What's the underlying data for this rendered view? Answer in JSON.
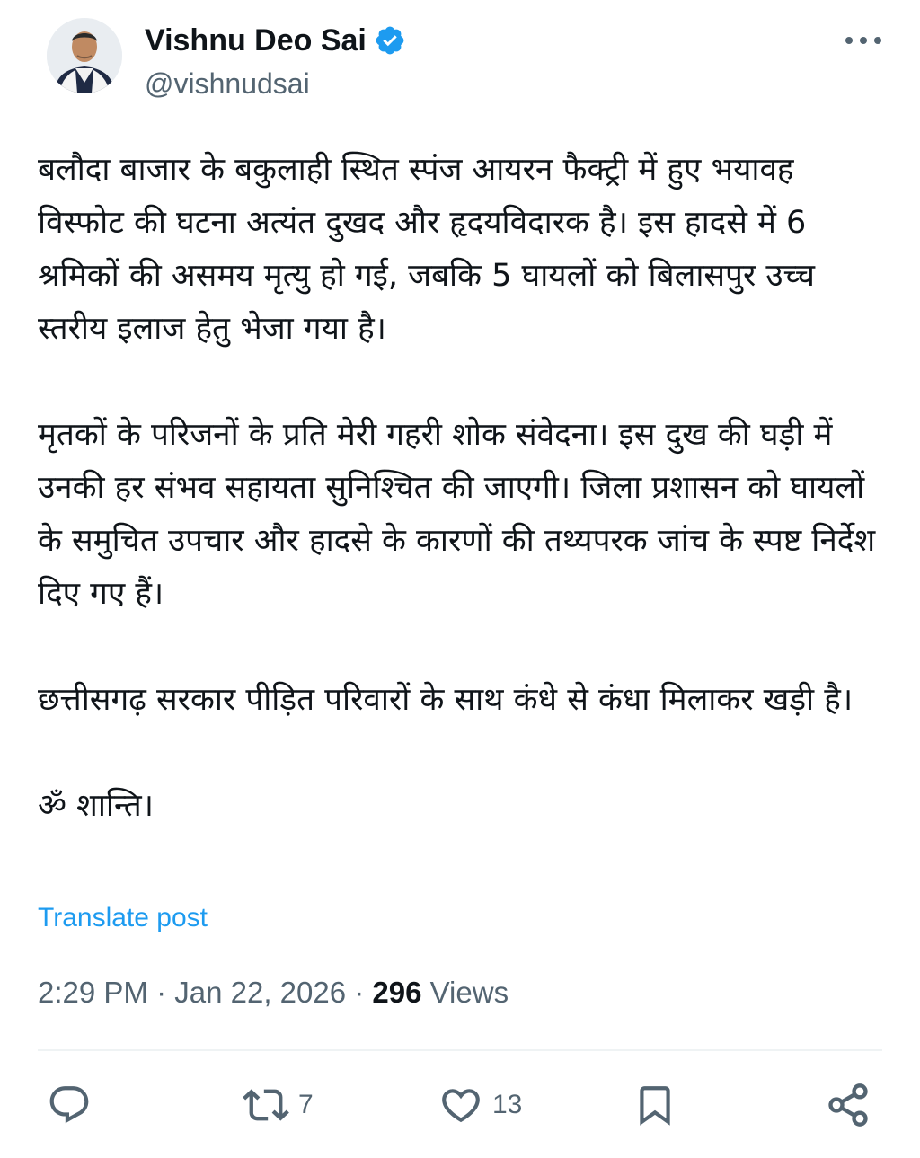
{
  "author": {
    "name": "Vishnu Deo Sai",
    "handle": "@vishnudsai",
    "avatar_icon": "profile-photo",
    "verified_icon": "verified-badge-icon",
    "verified_color": "#1d9bf0"
  },
  "tweet": {
    "paragraphs": [
      "बलौदा बाजार के बकुलाही स्थित स्पंज आयरन फैक्ट्री में हुए भयावह विस्फोट की घटना अत्यंत दुखद और हृदयविदारक है। इस हादसे में 6 श्रमिकों की असमय मृत्यु हो गई, जबकि 5 घायलों को बिलासपुर उच्च स्तरीय इलाज हेतु भेजा गया है।",
      "मृतकों के परिजनों के प्रति मेरी गहरी शोक संवेदना। इस दुख की घड़ी में उनकी हर संभव सहायता सुनिश्चित की जाएगी। जिला प्रशासन को घायलों के समुचित उपचार और हादसे के कारणों की तथ्यपरक जांच के स्पष्ट निर्देश दिए गए हैं।",
      "छत्तीसगढ़ सरकार पीड़ित परिवारों के साथ कंधे से कंधा मिलाकर खड़ी है।",
      "ॐ शान्ति।"
    ],
    "translate_label": "Translate post"
  },
  "meta": {
    "time": "2:29 PM",
    "separator": " · ",
    "date": "Jan 22, 2026",
    "views_count": "296",
    "views_label": " Views"
  },
  "actions": {
    "reply": {
      "icon": "reply-icon",
      "count": ""
    },
    "repost": {
      "icon": "repost-icon",
      "count": "7"
    },
    "like": {
      "icon": "like-icon",
      "count": "13"
    },
    "bookmark": {
      "icon": "bookmark-icon",
      "count": ""
    },
    "share": {
      "icon": "share-icon",
      "count": ""
    }
  },
  "colors": {
    "text": "#0f1419",
    "secondary": "#536471",
    "link": "#1d9bf0",
    "divider": "#eff3f4"
  }
}
